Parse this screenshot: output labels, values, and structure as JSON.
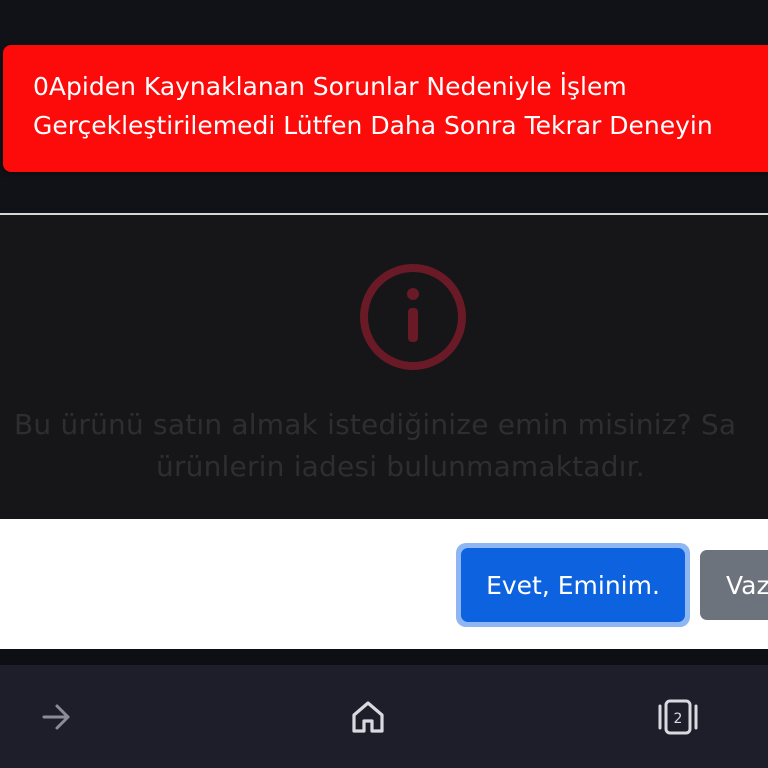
{
  "toast": {
    "line1": "0Apiden Kaynaklanan Sorunlar Nedeniyle İşlem",
    "line2": "Gerçekleştirilemedi Lütfen Daha Sonra Tekrar Deneyin",
    "color": "#fd0a0a"
  },
  "modal": {
    "icon": "info-icon",
    "message_line1": "Bu ürünü satın almak istediğinize emin misiniz? Sa",
    "message_line2": "ürünlerin iadesi bulunmamaktadır.",
    "confirm_label": "Evet, Eminim.",
    "cancel_label": "Vaz",
    "confirm_color": "#0d62df",
    "cancel_color": "#6c737c"
  },
  "nav": {
    "back_icon": "arrow-right-icon",
    "home_icon": "home-icon",
    "tabs_icon": "tabs-icon",
    "tab_count": "2"
  }
}
